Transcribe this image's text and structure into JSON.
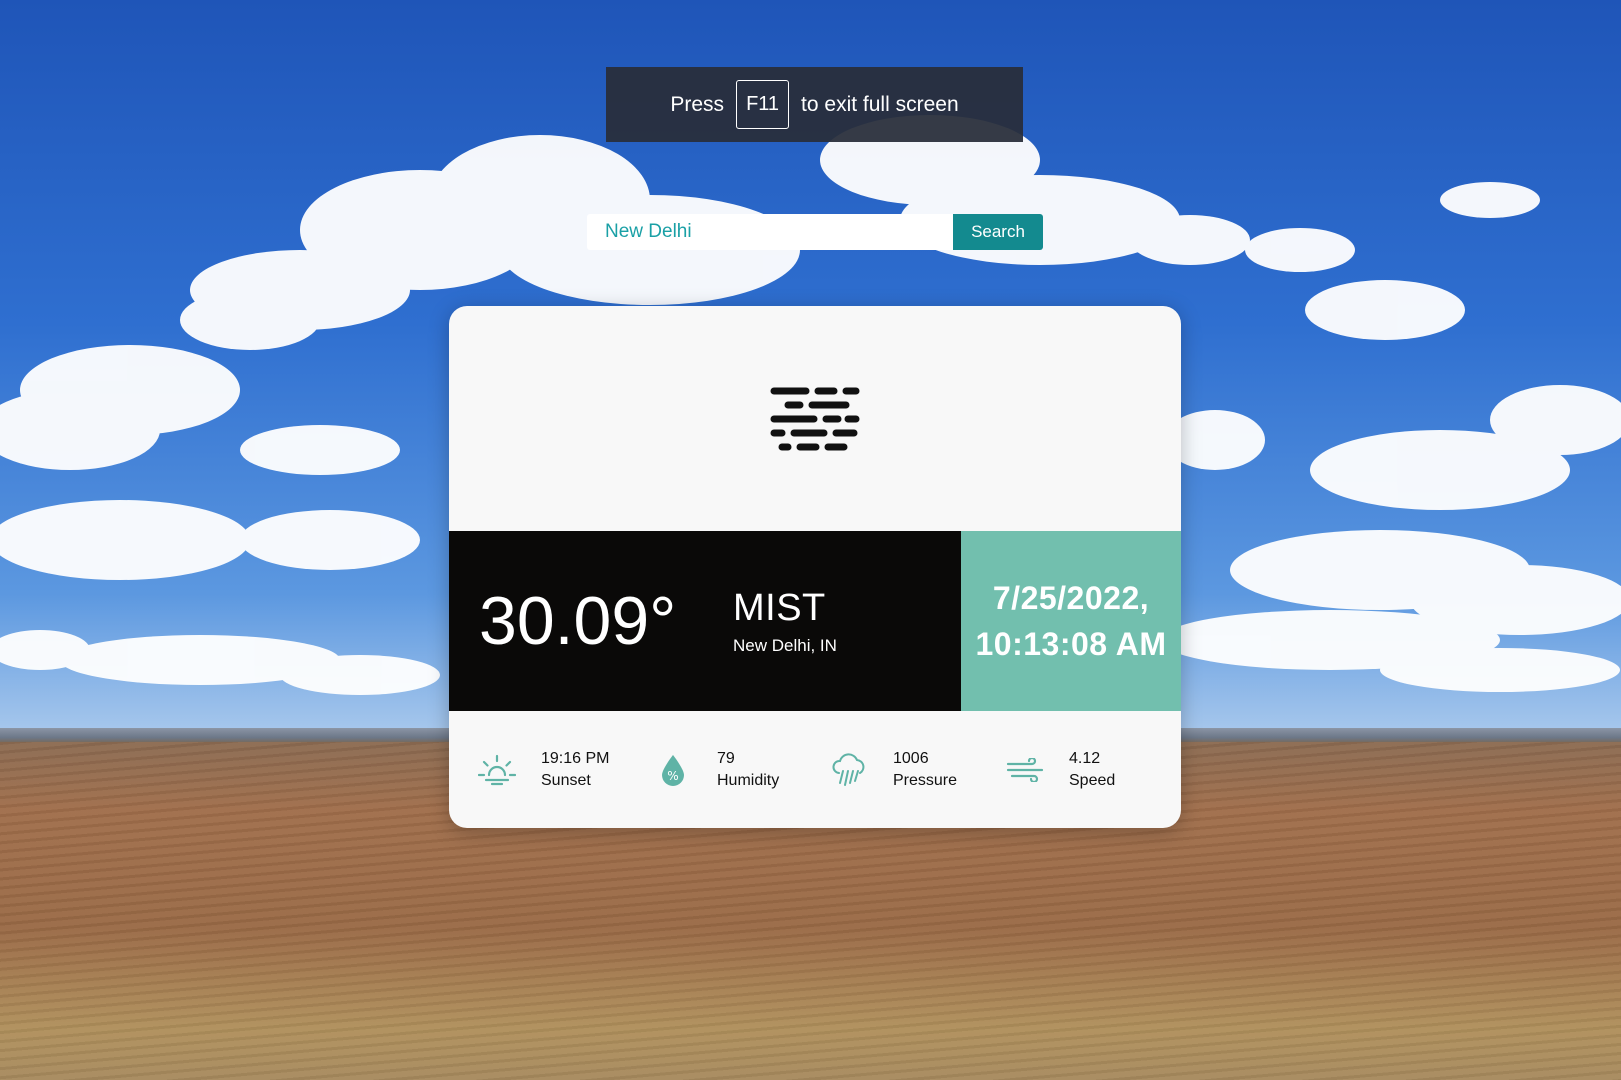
{
  "fullscreen_notice": {
    "prefix": "Press",
    "key": "F11",
    "suffix": "to exit full screen"
  },
  "search": {
    "value": "New Delhi",
    "button_label": "Search"
  },
  "weather": {
    "icon": "mist-icon",
    "temperature": "30.09°",
    "condition": "MIST",
    "location": "New Delhi, IN",
    "date": "7/25/2022,",
    "time": "10:13:08 AM"
  },
  "stats": [
    {
      "icon": "sunset-icon",
      "value": "19:16 PM",
      "label": "Sunset"
    },
    {
      "icon": "humidity-icon",
      "value": "79",
      "label": "Humidity"
    },
    {
      "icon": "pressure-icon",
      "value": "1006",
      "label": "Pressure"
    },
    {
      "icon": "wind-icon",
      "value": "4.12",
      "label": "Speed"
    }
  ],
  "colors": {
    "accent": "#72bfae",
    "button": "#138a8f",
    "icon": "#5fb3a6"
  }
}
